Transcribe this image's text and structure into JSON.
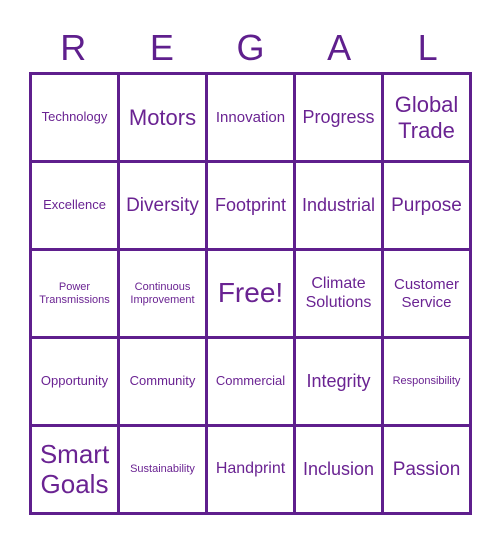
{
  "header": {
    "letters": [
      "R",
      "E",
      "G",
      "A",
      "L"
    ]
  },
  "colors": {
    "accent": "#5f1f8d",
    "text": "#6a2392"
  },
  "cells": [
    "Technology",
    "Motors",
    "Innovation",
    "Progress",
    "Global Trade",
    "Excellence",
    "Diversity",
    "Footprint",
    "Industrial",
    "Purpose",
    "Power Transmissions",
    "Continuous Improvement",
    "Free!",
    "Climate Solutions",
    "Customer Service",
    "Opportunity",
    "Community",
    "Commercial",
    "Integrity",
    "Responsibility",
    "Smart Goals",
    "Sustainability",
    "Handprint",
    "Inclusion",
    "Passion"
  ]
}
